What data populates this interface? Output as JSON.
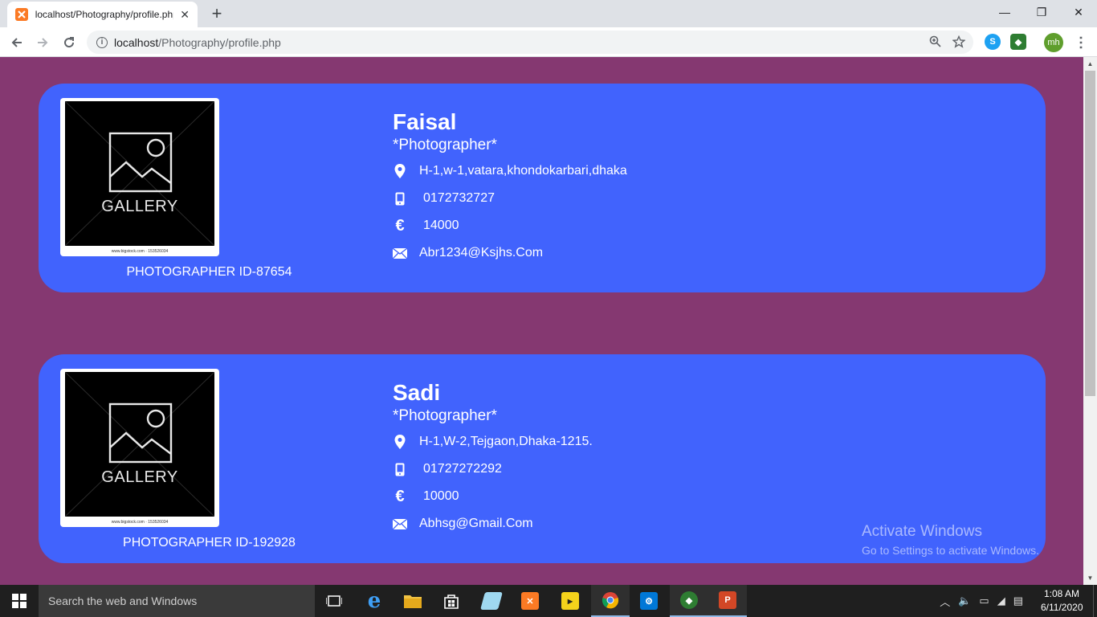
{
  "browser": {
    "tab_title": "localhost/Photography/profile.php",
    "tab_close": "✕",
    "new_tab": "+",
    "url_host": "localhost",
    "url_path": "/Photography/profile.php",
    "profile_initials": "mh",
    "window_controls": {
      "minimize": "—",
      "maximize": "❐",
      "close": "✕"
    }
  },
  "profiles": [
    {
      "name": "Faisal",
      "role": "*Photographer*",
      "address": "H-1,w-1,vatara,khondokarbari,dhaka",
      "phone": "0172732727",
      "rate": "14000",
      "email": "Abr1234@Ksjhs.Com",
      "photographer_id": "PHOTOGRAPHER ID-87654",
      "photo_label": "GALLERY",
      "photo_caption": "www.bigstock.com · 153526034"
    },
    {
      "name": "Sadi",
      "role": "*Photographer*",
      "address": "H-1,W-2,Tejgaon,Dhaka-1215.",
      "phone": "01727272292",
      "rate": "10000",
      "email": "Abhsg@Gmail.Com",
      "photographer_id": "PHOTOGRAPHER ID-192928",
      "photo_label": "GALLERY",
      "photo_caption": "www.bigstock.com · 153526034"
    }
  ],
  "watermark": {
    "line1": "Activate Windows",
    "line2": "Go to Settings to activate Windows."
  },
  "taskbar": {
    "search_placeholder": "Search the web and Windows",
    "time": "1:08 AM",
    "date": "6/11/2020"
  },
  "colors": {
    "page_bg": "#853871",
    "card_bg": "#4163fd",
    "text": "#ffffff"
  }
}
